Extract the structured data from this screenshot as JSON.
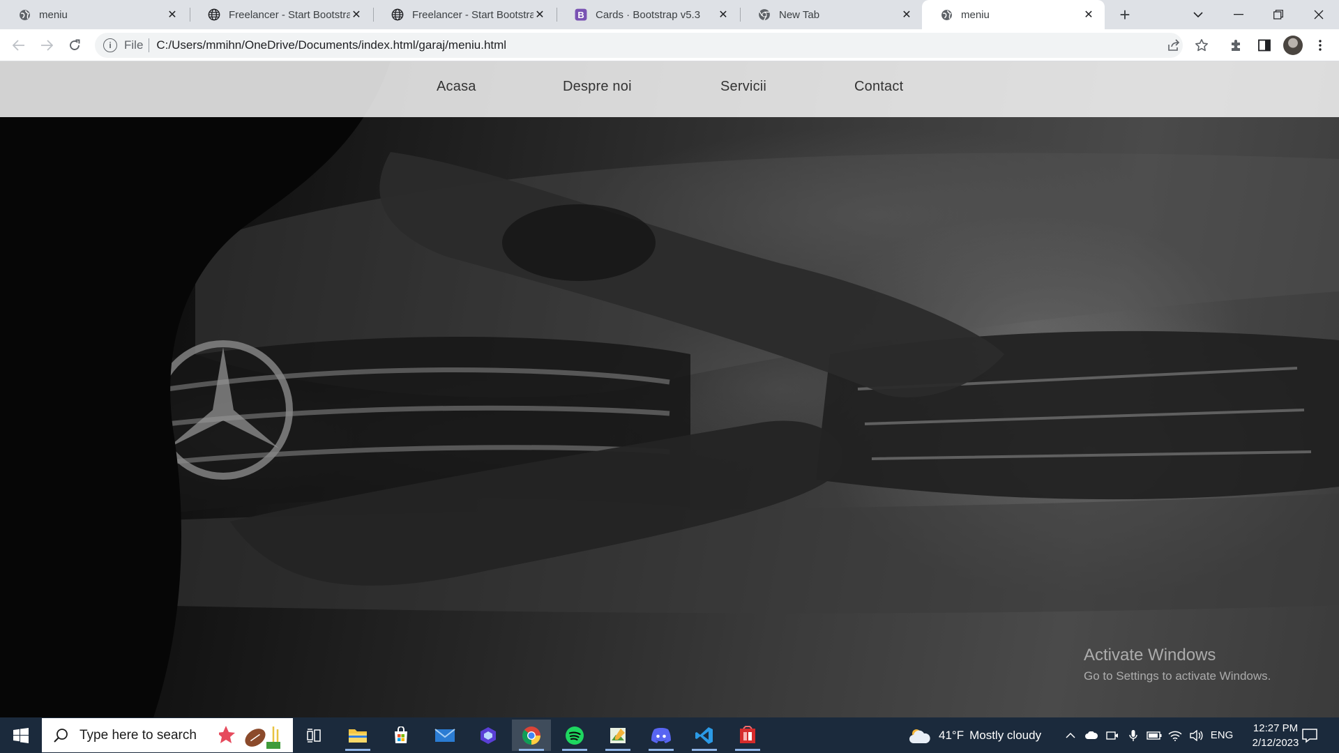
{
  "browser": {
    "tabs": [
      {
        "title": "meniu",
        "icon": "globe-icon"
      },
      {
        "title": "Freelancer - Start Bootstrap",
        "icon": "globe-icon"
      },
      {
        "title": "Freelancer - Start Bootstrap",
        "icon": "globe-icon"
      },
      {
        "title": "Cards · Bootstrap v5.3",
        "icon": "bootstrap-icon"
      },
      {
        "title": "New Tab",
        "icon": "chrome-icon"
      },
      {
        "title": "meniu",
        "icon": "globe-icon"
      }
    ],
    "address": {
      "scheme_label": "File",
      "url": "C:/Users/mmihn/OneDrive/Documents/index.html/garaj/meniu.html"
    }
  },
  "page": {
    "nav": [
      "Acasa",
      "Despre noi",
      "Servicii",
      "Contact"
    ]
  },
  "watermark": {
    "title": "Activate Windows",
    "subtitle": "Go to Settings to activate Windows."
  },
  "taskbar": {
    "search_placeholder": "Type here to search",
    "weather": {
      "temperature": "41°F",
      "condition": "Mostly cloudy"
    },
    "language": "ENG",
    "time": "12:27 PM",
    "date": "2/12/2023"
  },
  "colors": {
    "tab_strip": "#dee1e6",
    "taskbar": "#1b2a3c",
    "nav_bar": "#ffffff",
    "spotify": "#1ed760",
    "vscode": "#2b9ae6",
    "discord": "#5865f2"
  }
}
